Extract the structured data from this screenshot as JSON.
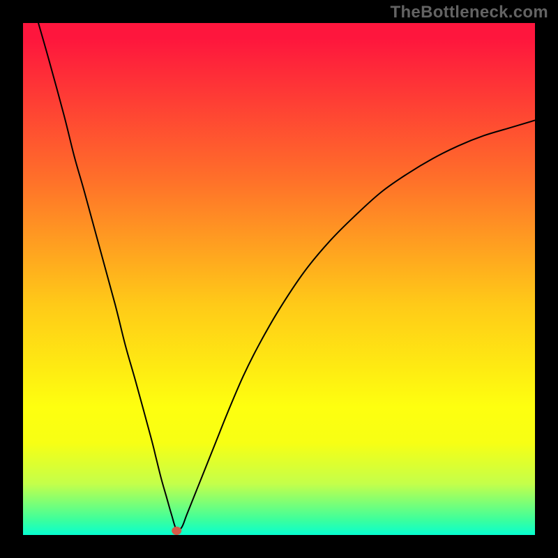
{
  "watermark": "TheBottleneck.com",
  "colors": {
    "frame": "#000000",
    "gradient_top": "#fe163d",
    "gradient_mid1": "#ff6e2a",
    "gradient_mid2": "#ffca18",
    "gradient_mid3": "#feff0f",
    "gradient_bottom": "#07ffd0",
    "curve": "#000000",
    "marker": "#d45a48"
  },
  "chart_data": {
    "type": "line",
    "title": "",
    "xlabel": "",
    "ylabel": "",
    "x_range": [
      0,
      100
    ],
    "y_range": [
      0,
      100
    ],
    "grid": false,
    "legend": false,
    "marker": {
      "x": 30,
      "y": 0
    },
    "series": [
      {
        "name": "curve",
        "x": [
          3,
          5,
          8,
          10,
          12,
          15,
          18,
          20,
          22,
          25,
          26,
          27,
          28,
          29,
          30,
          31,
          32,
          34,
          36,
          38,
          40,
          43,
          46,
          50,
          55,
          60,
          65,
          70,
          75,
          80,
          85,
          90,
          95,
          100
        ],
        "y": [
          100,
          93,
          82,
          74,
          67,
          56,
          45,
          37,
          30,
          19,
          15,
          11,
          7.5,
          4,
          1,
          1.5,
          4,
          9,
          14,
          19,
          24,
          31,
          37,
          44,
          51.5,
          57.5,
          62.5,
          67,
          70.5,
          73.5,
          76,
          78,
          79.5,
          81
        ]
      }
    ]
  }
}
